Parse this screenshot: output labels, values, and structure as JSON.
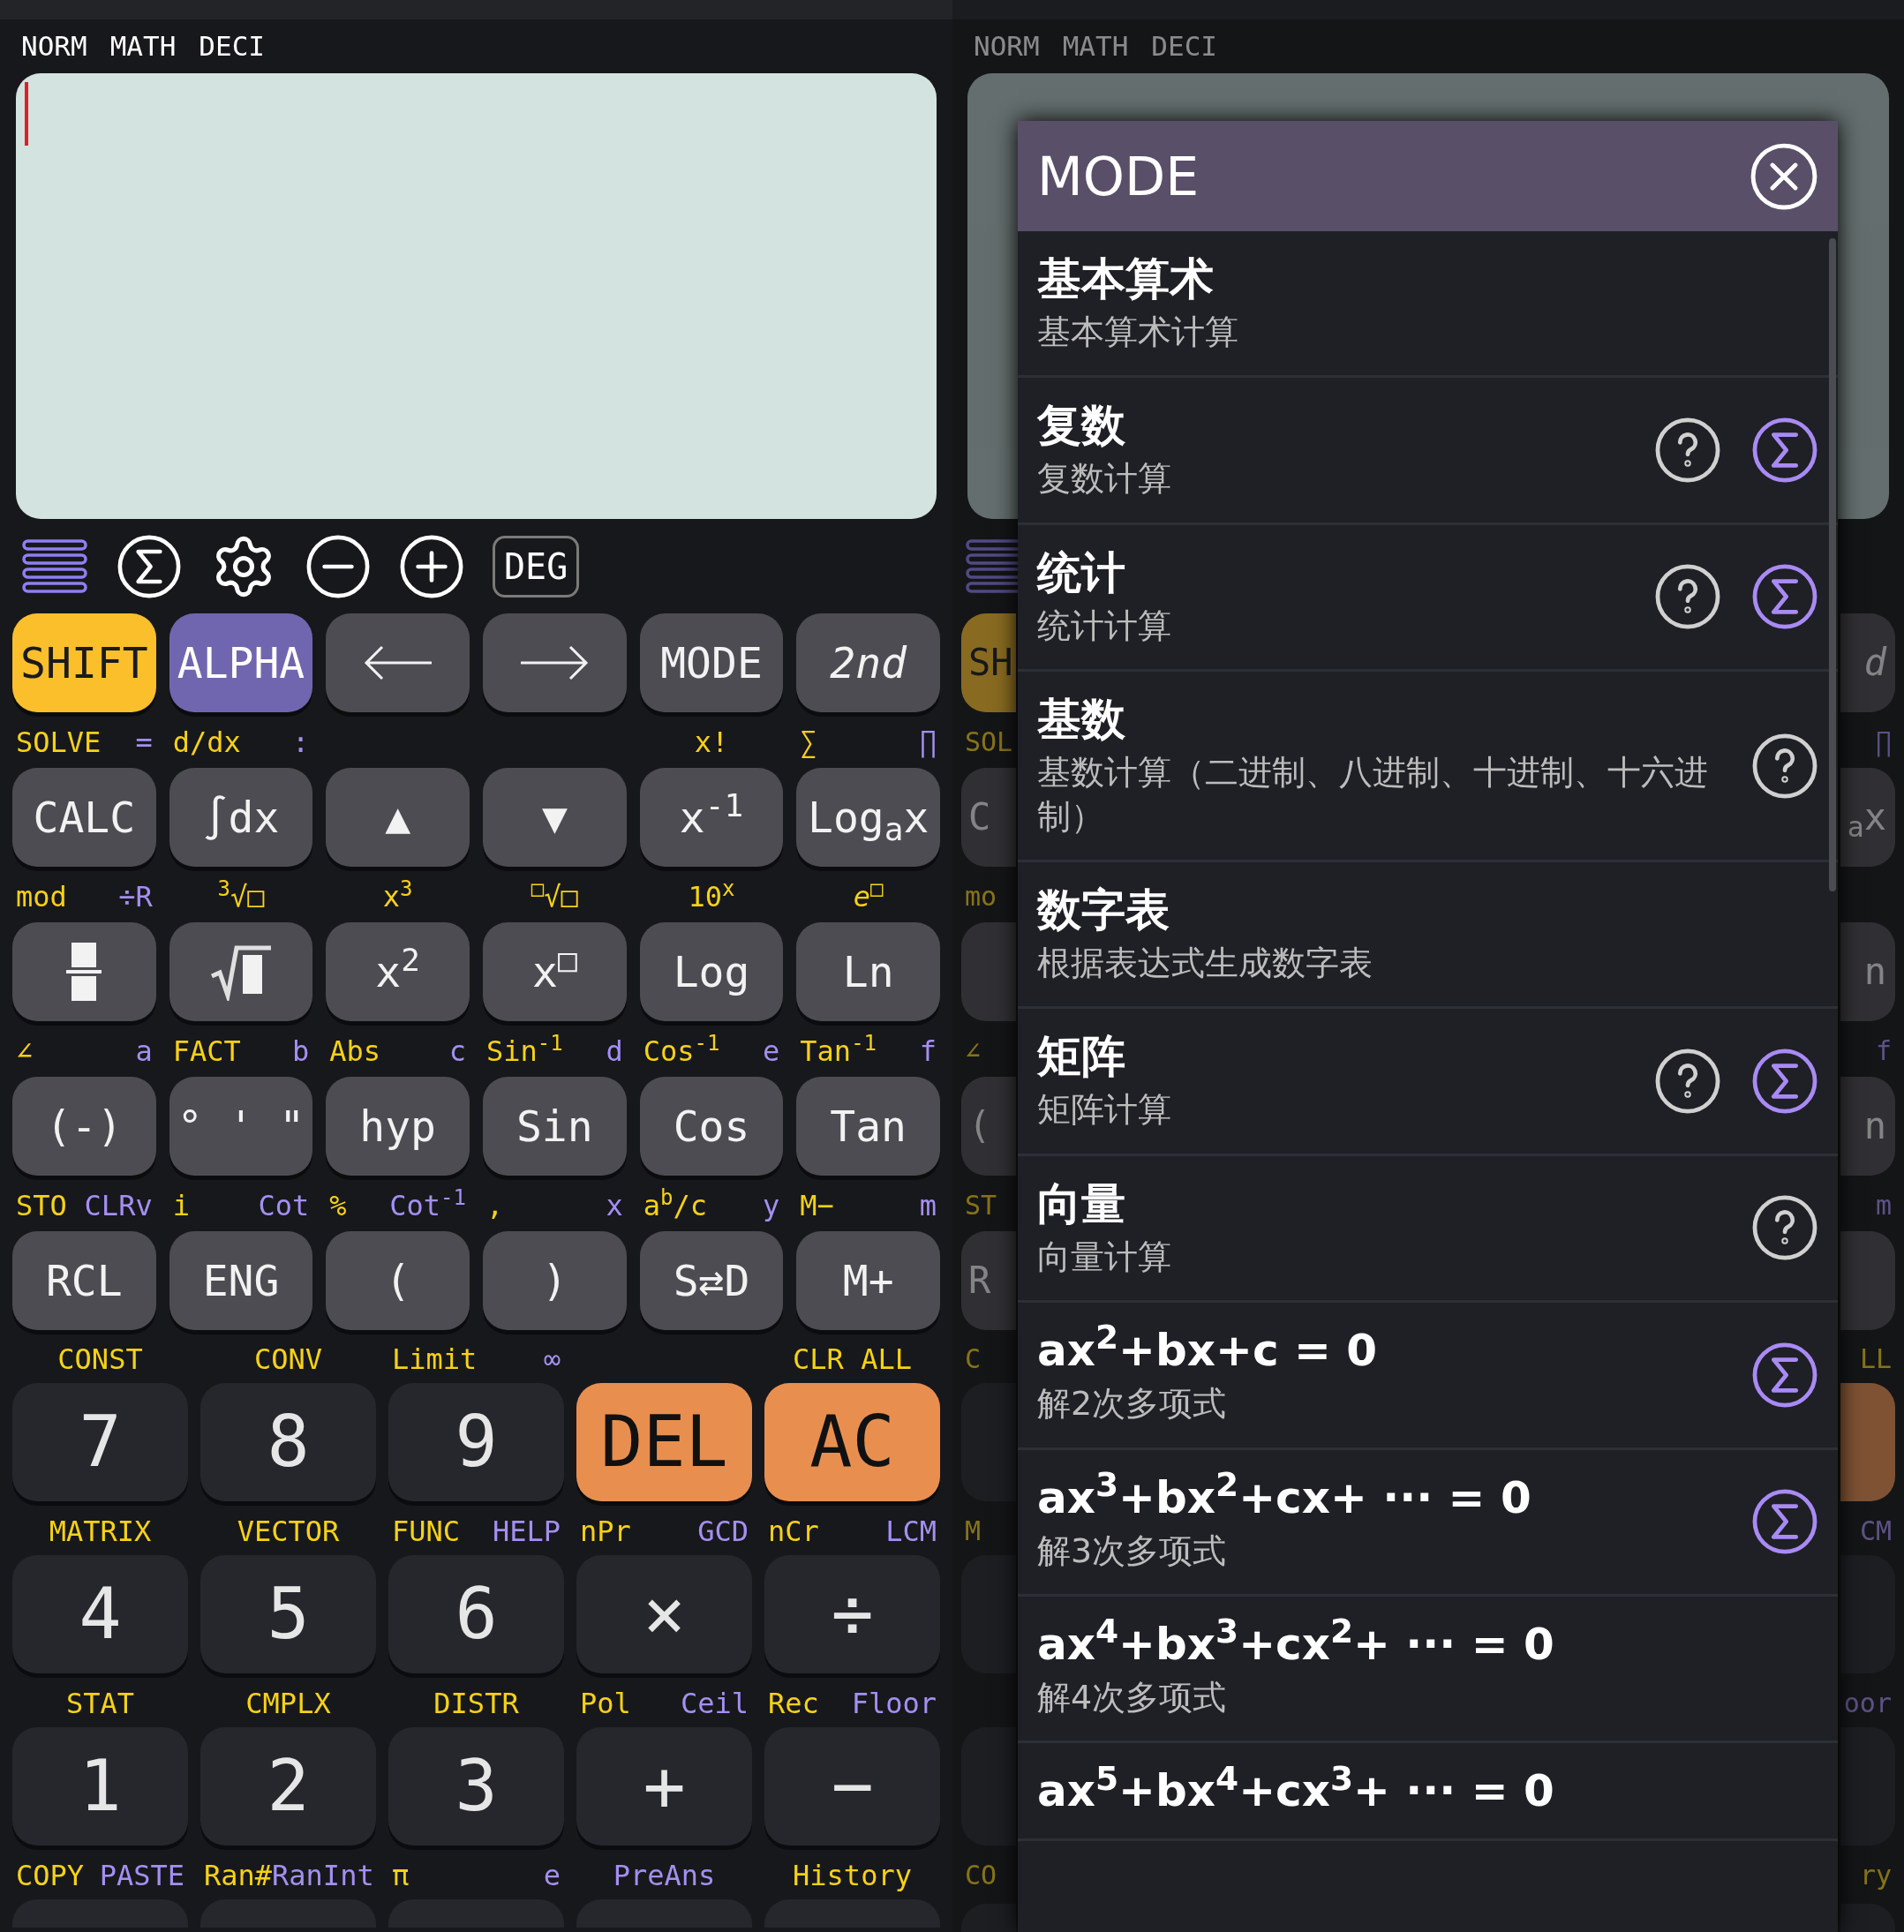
{
  "calculator": {
    "status": [
      "NORM",
      "MATH",
      "DECI"
    ],
    "toolbar": {
      "angle_button": "DEG"
    },
    "function_rows": [
      [
        {
          "label": "SHIFT",
          "kind": "shift"
        },
        {
          "label": "ALPHA",
          "kind": "alpha"
        },
        {
          "kind": "arrow-left"
        },
        {
          "kind": "arrow-right"
        },
        {
          "label": "MODE",
          "kind": "function"
        },
        {
          "label": "2nd",
          "kind": "function",
          "italic": true
        }
      ],
      [
        {
          "label": "CALC",
          "kind": "function",
          "shift": "SOLVE",
          "alpha": "="
        },
        {
          "label": "∫dx",
          "kind": "function",
          "shift": "d/dx",
          "alpha": ":"
        },
        {
          "label": "▲",
          "kind": "function"
        },
        {
          "label": "▼",
          "kind": "function"
        },
        {
          "label": "x$^{-1}$",
          "kind": "function",
          "shift": "x!"
        },
        {
          "label": "Log$_{a}$x",
          "kind": "function",
          "shift": "∑",
          "alpha": "∏"
        }
      ],
      [
        {
          "kind": "fraction",
          "shift": "mod",
          "alpha": "÷R"
        },
        {
          "kind": "root",
          "shift": "$^{3}$√□"
        },
        {
          "label": "x$^{2}$",
          "kind": "function",
          "shift": "x$^{3}$"
        },
        {
          "label": "x$^{□}$",
          "kind": "function",
          "shift": "$^{□}$√□"
        },
        {
          "label": "Log",
          "kind": "function",
          "shift": "10$^{x}$"
        },
        {
          "label": "Ln",
          "kind": "function",
          "shift": "*e*$^{□}$"
        }
      ],
      [
        {
          "label": "(-)",
          "kind": "function",
          "shift": "∠",
          "alpha": "a"
        },
        {
          "label": "° ' \"",
          "kind": "function",
          "shift": "FACT",
          "alpha": "b"
        },
        {
          "label": "hyp",
          "kind": "function",
          "shift": "Abs",
          "alpha": "c"
        },
        {
          "label": "Sin",
          "kind": "function",
          "shift": "Sin$^{-1}$",
          "alpha": "d"
        },
        {
          "label": "Cos",
          "kind": "function",
          "shift": "Cos$^{-1}$",
          "alpha": "e"
        },
        {
          "label": "Tan",
          "kind": "function",
          "shift": "Tan$^{-1}$",
          "alpha": "f"
        }
      ],
      [
        {
          "label": "RCL",
          "kind": "function",
          "shift": "STO",
          "alpha": "CLRv"
        },
        {
          "label": "ENG",
          "kind": "function",
          "shift": "i",
          "alpha": "Cot"
        },
        {
          "label": "(",
          "kind": "function",
          "shift": "%",
          "alpha": "Cot$^{-1}$"
        },
        {
          "label": ")",
          "kind": "function",
          "shift": ",",
          "alpha": "x"
        },
        {
          "label": "S⇄D",
          "kind": "function",
          "shift": "a$^{b}$/c",
          "alpha": "y"
        },
        {
          "label": "M+",
          "kind": "function",
          "shift": "M−",
          "alpha": "m"
        }
      ]
    ],
    "number_rows": [
      [
        {
          "label": "7",
          "kind": "number",
          "shift": "CONST"
        },
        {
          "label": "8",
          "kind": "number",
          "shift": "CONV"
        },
        {
          "label": "9",
          "kind": "number",
          "shift": "Limit",
          "alpha": "∞"
        },
        {
          "label": "DEL",
          "kind": "clear"
        },
        {
          "label": "AC",
          "kind": "clear",
          "shift": "CLR ALL"
        }
      ],
      [
        {
          "label": "4",
          "kind": "number",
          "shift": "MATRIX"
        },
        {
          "label": "5",
          "kind": "number",
          "shift": "VECTOR"
        },
        {
          "label": "6",
          "kind": "number",
          "shift": "FUNC",
          "alpha": "HELP"
        },
        {
          "label": "×",
          "kind": "number",
          "shift": "nPr",
          "alpha": "GCD"
        },
        {
          "label": "÷",
          "kind": "number",
          "shift": "nCr",
          "alpha": "LCM"
        }
      ],
      [
        {
          "label": "1",
          "kind": "number",
          "shift": "STAT"
        },
        {
          "label": "2",
          "kind": "number",
          "shift": "CMPLX"
        },
        {
          "label": "3",
          "kind": "number",
          "shift": "DISTR"
        },
        {
          "label": "+",
          "kind": "number",
          "shift": "Pol",
          "alpha": "Ceil"
        },
        {
          "label": "−",
          "kind": "number",
          "shift": "Rec",
          "alpha": "Floor"
        }
      ],
      [
        {
          "kind": "number",
          "shift": "COPY",
          "alpha": "PASTE"
        },
        {
          "kind": "number",
          "shift": "Ran#",
          "alpha": "RanInt"
        },
        {
          "kind": "number",
          "shift": "π",
          "alpha": "e"
        },
        {
          "kind": "number",
          "alpha": "PreAns"
        },
        {
          "kind": "number",
          "shift": "History"
        }
      ]
    ]
  },
  "backdrop": {
    "status": [
      "NORM",
      "MATH",
      "DECI"
    ],
    "left_edge": [
      {
        "key": "SH",
        "kind": "shift"
      },
      {
        "shift": "SOL",
        "key": "C",
        "kind": "function"
      },
      {
        "shift": "mo",
        "kind": "function"
      },
      {
        "shift": "∠",
        "key": "(",
        "kind": "function"
      },
      {
        "shift": "ST",
        "key": "R",
        "kind": "function"
      },
      {
        "shift": "C",
        "kind": "number"
      },
      {
        "shift": "M",
        "kind": "number"
      },
      {
        "kind": "number"
      },
      {
        "shift": "CO",
        "kind": "number"
      }
    ],
    "right_edge": [
      {
        "key": "d",
        "kind": "function",
        "italic": true
      },
      {
        "alpha": "∏",
        "key": "$_{a}$x",
        "kind": "function"
      },
      {
        "key": "n",
        "kind": "function"
      },
      {
        "alpha": "f",
        "key": "n",
        "kind": "function"
      },
      {
        "alpha": "m",
        "kind": "function"
      },
      {
        "shift": "LL",
        "kind": "clear"
      },
      {
        "alpha": "CM",
        "kind": "number"
      },
      {
        "alpha": "oor",
        "kind": "number"
      },
      {
        "shift": "ry",
        "kind": "number"
      }
    ]
  },
  "mode_dialog": {
    "title": "MODE",
    "items": [
      {
        "title": "基本算术",
        "subtitle": "基本算术计算",
        "help": false,
        "sigma": false
      },
      {
        "title": "复数",
        "subtitle": "复数计算",
        "help": true,
        "sigma": true
      },
      {
        "title": "统计",
        "subtitle": "统计计算",
        "help": true,
        "sigma": true
      },
      {
        "title": "基数",
        "subtitle": "基数计算（二进制、八进制、十进制、十六进制）",
        "help": true,
        "sigma": false
      },
      {
        "title": "数字表",
        "subtitle": "根据表达式生成数字表",
        "help": false,
        "sigma": false
      },
      {
        "title": "矩阵",
        "subtitle": "矩阵计算",
        "help": true,
        "sigma": true
      },
      {
        "title": "向量",
        "subtitle": "向量计算",
        "help": true,
        "sigma": false
      },
      {
        "title": "ax$^{2}$+bx+c = 0",
        "subtitle": "解2次多项式",
        "help": false,
        "sigma": true
      },
      {
        "title": "ax$^{3}$+bx$^{2}$+cx+ ··· = 0",
        "subtitle": "解3次多项式",
        "help": false,
        "sigma": true
      },
      {
        "title": "ax$^{4}$+bx$^{3}$+cx$^{2}$+ ··· = 0",
        "subtitle": "解4次多项式",
        "help": false,
        "sigma": false
      },
      {
        "title": "ax$^{5}$+bx$^{4}$+cx$^{3}$+ ··· = 0",
        "help": false,
        "sigma": false
      }
    ]
  }
}
